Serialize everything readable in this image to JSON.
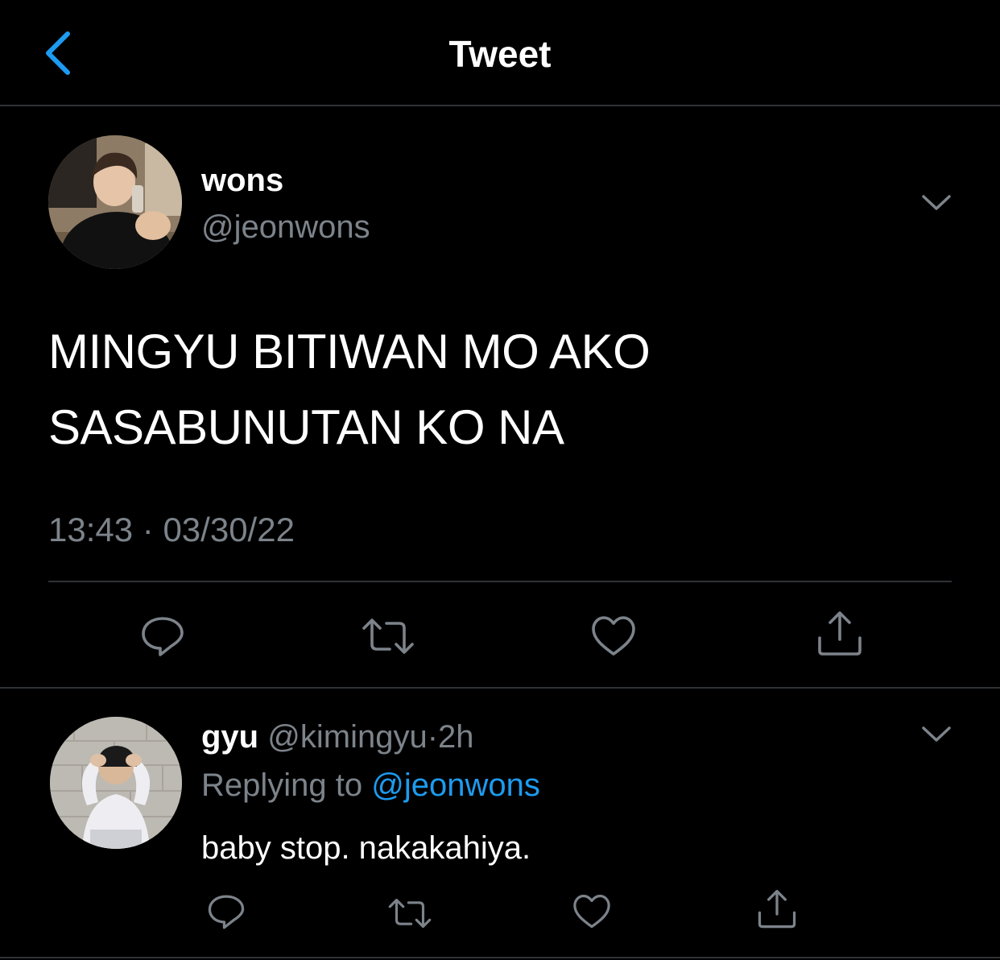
{
  "header": {
    "title": "Tweet",
    "back_icon": "chevron-left-icon"
  },
  "colors": {
    "accent": "#1d9bf0",
    "muted": "#7c838a",
    "divider": "#2f3336",
    "background": "#000000"
  },
  "tweet": {
    "name": "wons",
    "handle": "@jeonwons",
    "text_lines": [
      "MINGYU BITIWAN MO AKO",
      "SASABUNUTAN KO NA"
    ],
    "time": "13:43",
    "separator": "·",
    "date": "03/30/22",
    "actions": [
      "reply-icon",
      "retweet-icon",
      "like-icon",
      "share-icon"
    ]
  },
  "reply": {
    "name": "gyu",
    "handle": "@kimingyu",
    "separator": "·",
    "age": "2h",
    "replying_label": "Replying to",
    "replying_handle": "@jeonwons",
    "text": "baby stop. nakakahiya.",
    "actions": [
      "reply-icon",
      "retweet-icon",
      "like-icon",
      "share-icon"
    ]
  }
}
